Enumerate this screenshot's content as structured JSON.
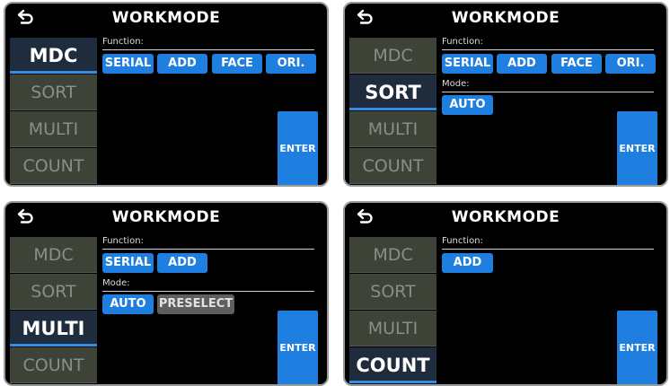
{
  "screens": [
    {
      "title": "WORKMODE",
      "sidebar": [
        "MDC",
        "SORT",
        "MULTI",
        "COUNT"
      ],
      "active": "MDC",
      "function_label": "Function:",
      "functions": [
        "SERIAL",
        "ADD",
        "FACE",
        "ORI."
      ],
      "enter": "ENTER"
    },
    {
      "title": "WORKMODE",
      "sidebar": [
        "MDC",
        "SORT",
        "MULTI",
        "COUNT"
      ],
      "active": "SORT",
      "function_label": "Function:",
      "functions": [
        "SERIAL",
        "ADD",
        "FACE",
        "ORI."
      ],
      "mode_label": "Mode:",
      "modes": [
        "AUTO"
      ],
      "enter": "ENTER"
    },
    {
      "title": "WORKMODE",
      "sidebar": [
        "MDC",
        "SORT",
        "MULTI",
        "COUNT"
      ],
      "active": "MULTI",
      "function_label": "Function:",
      "functions": [
        "SERIAL",
        "ADD"
      ],
      "mode_label": "Mode:",
      "modes": [
        "AUTO",
        "PRESELECT"
      ],
      "enter": "ENTER"
    },
    {
      "title": "WORKMODE",
      "sidebar": [
        "MDC",
        "SORT",
        "MULTI",
        "COUNT"
      ],
      "active": "COUNT",
      "function_label": "Function:",
      "functions": [
        "ADD"
      ],
      "enter": "ENTER"
    }
  ],
  "colors": {
    "accent": "#1e7fe0",
    "sidebar_bg": "#3d4337",
    "sidebar_active_bg": "#1e2c3d",
    "inactive_button": "#5e5e5e"
  },
  "icons": {
    "back": "back-arrow-icon"
  }
}
